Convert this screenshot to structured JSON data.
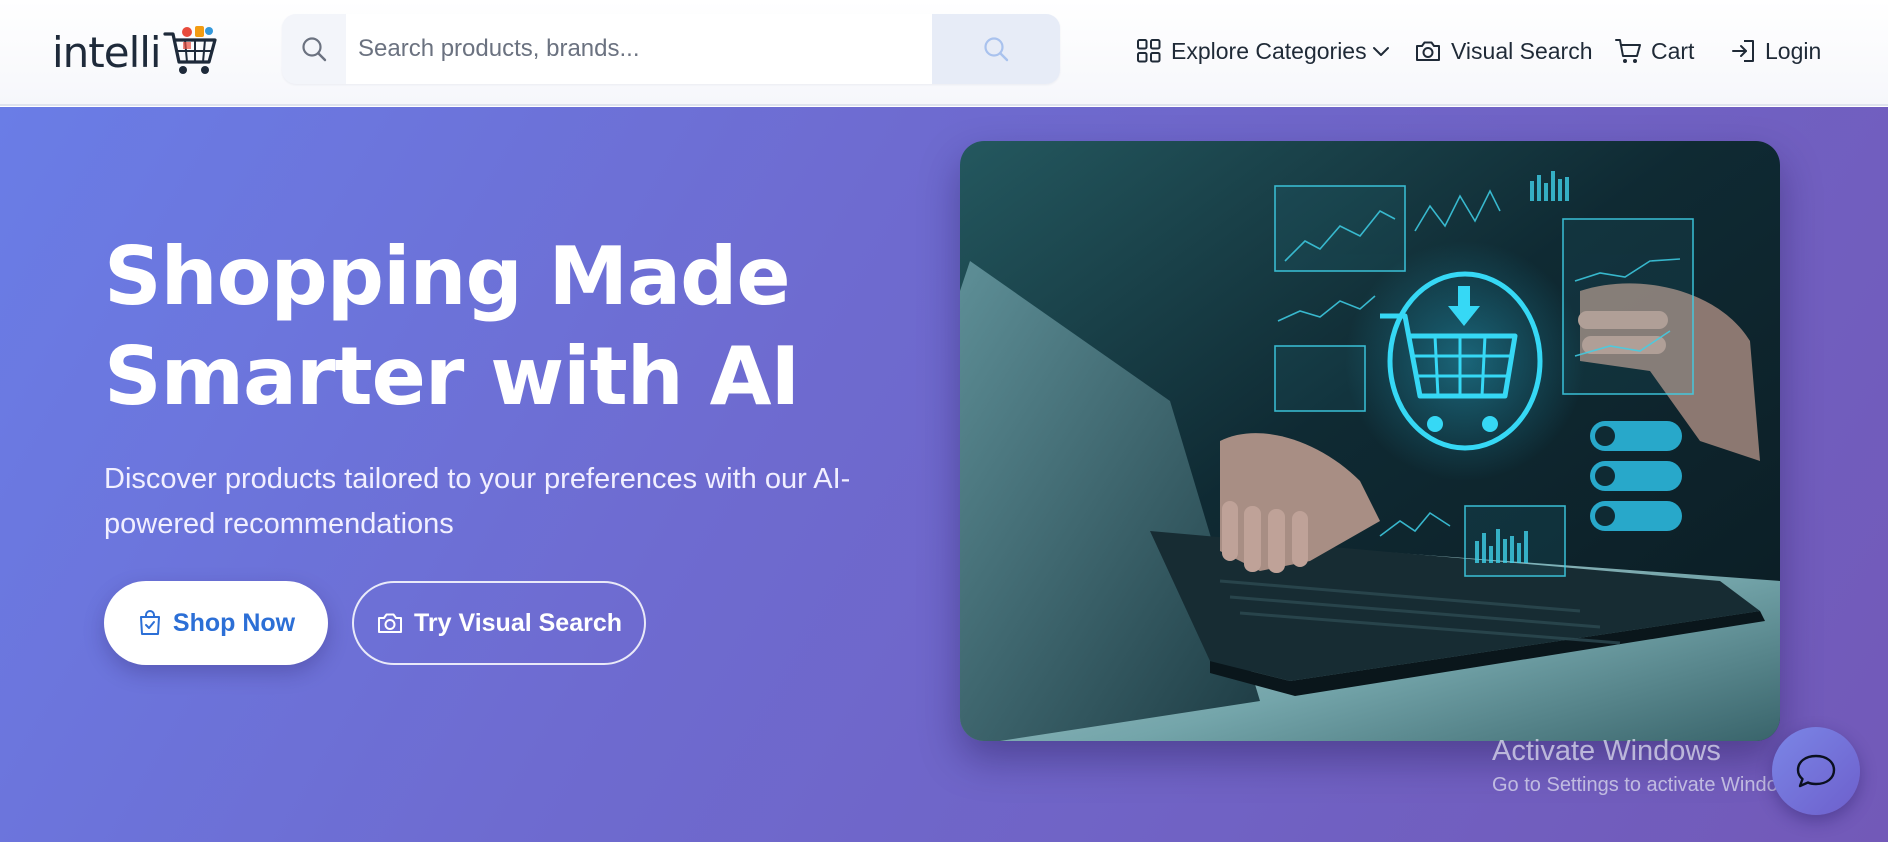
{
  "header": {
    "logo_text": "intelli",
    "search": {
      "placeholder": "Search products, brands..."
    },
    "nav": {
      "explore": "Explore Categories",
      "visual_search": "Visual Search",
      "cart": "Cart",
      "login": "Login"
    }
  },
  "hero": {
    "title_line1": "Shopping Made",
    "title_line2": "Smarter with AI",
    "subtitle": "Discover products tailored to your preferences with our AI-powered recommendations",
    "primary_button": "Shop Now",
    "secondary_button": "Try Visual Search"
  },
  "watermark": {
    "title": "Activate Windows",
    "subtitle": "Go to Settings to activate Windows."
  },
  "colors": {
    "accent": "#2c6fd6",
    "hero_start": "#6a7de6",
    "hero_end": "#7259b8",
    "text_dark": "#1f2a37"
  },
  "icons": [
    "search-icon",
    "grid-icon",
    "chevron-down-icon",
    "camera-icon",
    "cart-icon",
    "login-icon",
    "shopping-bag-icon",
    "chat-icon"
  ]
}
